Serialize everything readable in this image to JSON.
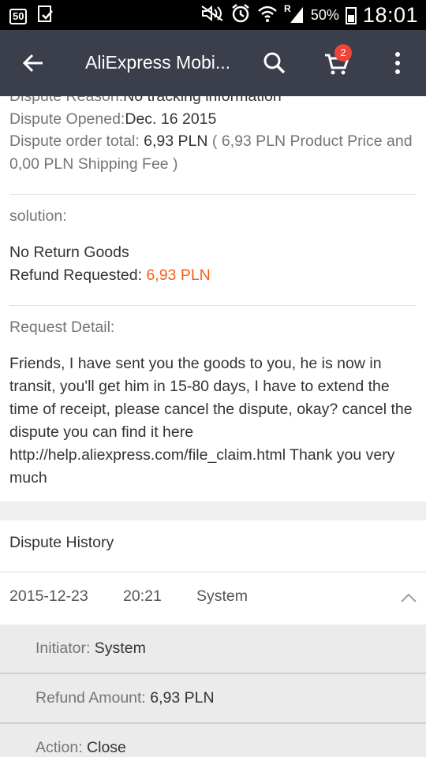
{
  "status_bar": {
    "left_icons": [
      "50",
      "download-check"
    ],
    "battery": "50%",
    "time": "18:01"
  },
  "app_bar": {
    "title": "AliExpress Mobi...",
    "cart_count": "2"
  },
  "dispute": {
    "reason_label": "Dispute Reason:",
    "reason_value": "No tracking information",
    "opened_label": "Dispute Opened:",
    "opened_value": "Dec. 16 2015",
    "total_label": "Dispute order total: ",
    "total_value": "6,93 PLN",
    "total_detail": " ( 6,93 PLN Product Price and 0,00 PLN Shipping Fee )"
  },
  "solution": {
    "label": "solution:",
    "return_text": "No Return Goods",
    "refund_label": "Refund Requested: ",
    "refund_value": "6,93 PLN"
  },
  "request": {
    "label": "Request Detail:",
    "text": "Friends, I have sent you the goods to you, he is now in transit, you'll get him in 15-80 days, I have to extend the time of receipt, please cancel the dispute, okay? cancel the dispute you can find it here http://help.aliexpress.com/file_claim.html Thank you very much"
  },
  "history": {
    "title": "Dispute History",
    "date": "2015-12-23",
    "time": "20:21",
    "actor": "System",
    "details": [
      {
        "label": "Initiator: ",
        "value": "System"
      },
      {
        "label": "Refund Amount: ",
        "value": "6,93 PLN"
      },
      {
        "label": "Action: ",
        "value": "Close"
      }
    ]
  },
  "colors": {
    "app_bar": "#3b3f4c",
    "accent": "#ff5a16",
    "badge": "#f0433a"
  }
}
